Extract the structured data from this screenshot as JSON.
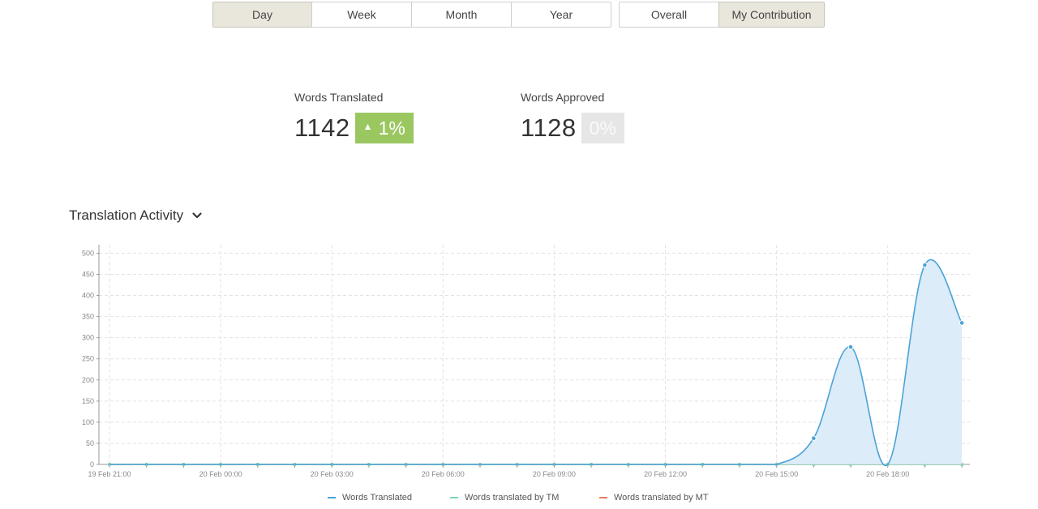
{
  "period_tabs": [
    {
      "label": "Day",
      "active": true
    },
    {
      "label": "Week",
      "active": false
    },
    {
      "label": "Month",
      "active": false
    },
    {
      "label": "Year",
      "active": false
    }
  ],
  "scope_tabs": [
    {
      "label": "Overall",
      "active": false
    },
    {
      "label": "My Contribution",
      "active": true
    }
  ],
  "stats": {
    "translated": {
      "label": "Words Translated",
      "value": "1142",
      "change": "1%",
      "trend": "up"
    },
    "approved": {
      "label": "Words Approved",
      "value": "1128",
      "change": "0%",
      "trend": "flat"
    }
  },
  "section": {
    "title": "Translation Activity",
    "icon": "chevron-down-icon"
  },
  "colors": {
    "accent_green": "#9bc760",
    "active_tab_bg": "#e9e6dc",
    "series_translated": "#4aa3d6",
    "series_tm": "#7fd1b9",
    "series_mt": "#e67e5a"
  },
  "chart_data": {
    "type": "area",
    "y_ticks": [
      "0",
      "50",
      "100",
      "150",
      "200",
      "250",
      "300",
      "350",
      "400",
      "450",
      "500"
    ],
    "ylim": [
      0,
      520
    ],
    "x_ticks": [
      "19 Feb 21:00",
      "20 Feb 00:00",
      "20 Feb 03:00",
      "20 Feb 06:00",
      "20 Feb 09:00",
      "20 Feb 12:00",
      "20 Feb 15:00",
      "20 Feb 18:00"
    ],
    "x_hours": [
      0,
      3,
      6,
      9,
      12,
      15,
      18,
      21
    ],
    "grid": true,
    "legend_position": "bottom",
    "series": [
      {
        "name": "Words Translated",
        "hours": [
          0,
          1,
          2,
          3,
          4,
          5,
          6,
          7,
          8,
          9,
          10,
          11,
          12,
          13,
          14,
          15,
          16,
          17,
          18,
          19,
          20,
          21,
          22,
          23
        ],
        "values": [
          0,
          0,
          0,
          0,
          0,
          0,
          0,
          0,
          0,
          0,
          0,
          0,
          0,
          0,
          0,
          0,
          0,
          0,
          0,
          62,
          278,
          0,
          472,
          335
        ]
      },
      {
        "name": "Words translated by TM",
        "hours": [
          0,
          1,
          2,
          3,
          4,
          5,
          6,
          7,
          8,
          9,
          10,
          11,
          12,
          13,
          14,
          15,
          16,
          17,
          18,
          19,
          20,
          21,
          22,
          23
        ],
        "values": [
          0,
          0,
          0,
          0,
          0,
          0,
          0,
          0,
          0,
          0,
          0,
          0,
          0,
          0,
          0,
          0,
          0,
          0,
          0,
          0,
          0,
          0,
          0,
          0
        ]
      },
      {
        "name": "Words translated by MT",
        "hours": [
          0,
          1,
          2,
          3,
          4,
          5,
          6,
          7,
          8,
          9,
          10,
          11,
          12,
          13,
          14,
          15,
          16,
          17,
          18,
          19,
          20,
          21,
          22,
          23
        ],
        "values": [
          0,
          0,
          0,
          0,
          0,
          0,
          0,
          0,
          0,
          0,
          0,
          0,
          0,
          0,
          0,
          0,
          0,
          0,
          0,
          0,
          0,
          0,
          0,
          0
        ]
      }
    ]
  }
}
